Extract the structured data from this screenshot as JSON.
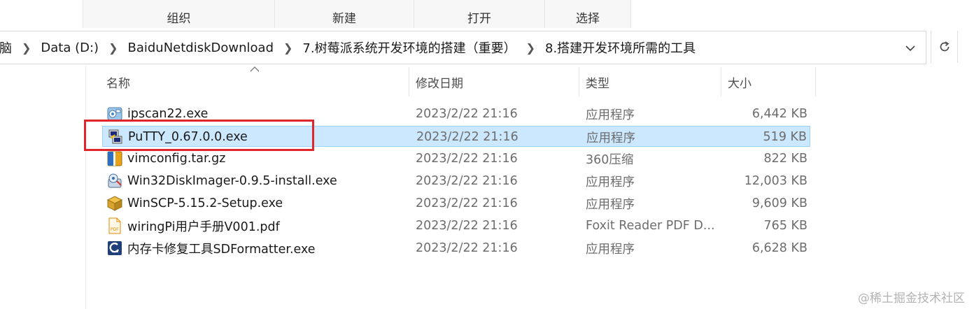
{
  "ribbon": {
    "groups": [
      {
        "label": "组织"
      },
      {
        "label": "新建"
      },
      {
        "label": "打开"
      },
      {
        "label": "选择"
      }
    ]
  },
  "address_bar": {
    "crumbs": [
      "脑",
      "Data (D:)",
      "BaiduNetdiskDownload",
      "7.树莓派系统开发环境的搭建（重要）",
      "8.搭建开发环境所需的工具"
    ],
    "dropdown_icon": "chevron-down-icon",
    "refresh_icon": "refresh-icon"
  },
  "columns": {
    "name": "名称",
    "date": "修改日期",
    "type": "类型",
    "size": "大小",
    "sort": "ascending"
  },
  "files": [
    {
      "name": "ipscan22.exe",
      "date": "2023/2/22 21:16",
      "type": "应用程序",
      "size": "6,442 KB",
      "icon": "ipscan-app-icon",
      "selected": false
    },
    {
      "name": "PuTTY_0.67.0.0.exe",
      "date": "2023/2/22 21:16",
      "type": "应用程序",
      "size": "519 KB",
      "icon": "putty-app-icon",
      "selected": true
    },
    {
      "name": "vimconfig.tar.gz",
      "date": "2023/2/22 21:16",
      "type": "360压缩",
      "size": "822 KB",
      "icon": "archive-icon",
      "selected": false
    },
    {
      "name": "Win32DiskImager-0.9.5-install.exe",
      "date": "2023/2/22 21:16",
      "type": "应用程序",
      "size": "12,003 KB",
      "icon": "installer-icon",
      "selected": false
    },
    {
      "name": "WinSCP-5.15.2-Setup.exe",
      "date": "2023/2/22 21:16",
      "type": "应用程序",
      "size": "9,609 KB",
      "icon": "package-icon",
      "selected": false
    },
    {
      "name": "wiringPi用户手册V001.pdf",
      "date": "2023/2/22 21:16",
      "type": "Foxit Reader PDF D...",
      "size": "765 KB",
      "icon": "pdf-icon",
      "selected": false
    },
    {
      "name": "内存卡修复工具SDFormatter.exe",
      "date": "2023/2/22 21:16",
      "type": "应用程序",
      "size": "6,628 KB",
      "icon": "sdformatter-icon",
      "selected": false
    }
  ],
  "colors": {
    "selection": "#cce8ff",
    "selection_border": "#99d1ff",
    "annotation": "#e0262a"
  },
  "watermark": "@稀土掘金技术社区"
}
